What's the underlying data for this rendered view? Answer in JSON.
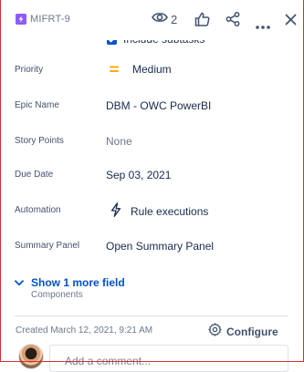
{
  "header": {
    "issue_key": "MIFRT-9",
    "watch_count": "2"
  },
  "subtasks": {
    "label": "Include subtasks",
    "checked": true
  },
  "fields": [
    {
      "label": "Priority",
      "value": "Medium",
      "icon": "priority-medium-icon"
    },
    {
      "label": "Epic Name",
      "value": "DBM - OWC PowerBI"
    },
    {
      "label": "Story Points",
      "value": "None"
    },
    {
      "label": "Due Date",
      "value": "Sep 03, 2021"
    },
    {
      "label": "Automation",
      "value": "Rule executions",
      "icon": "lightning-icon"
    },
    {
      "label": "Summary Panel",
      "value": "Open Summary Panel"
    }
  ],
  "show_more": {
    "label": "Show 1 more field",
    "hint": "Components"
  },
  "footer": {
    "created": "Created March 12, 2021, 9:21 AM",
    "configure_label": "Configure"
  },
  "comment": {
    "placeholder": "Add a comment..."
  },
  "colors": {
    "accent": "#0052cc",
    "issue_type": "#8b5cf6",
    "priority_medium": "#ffab00",
    "frame": "#d32f2f"
  }
}
